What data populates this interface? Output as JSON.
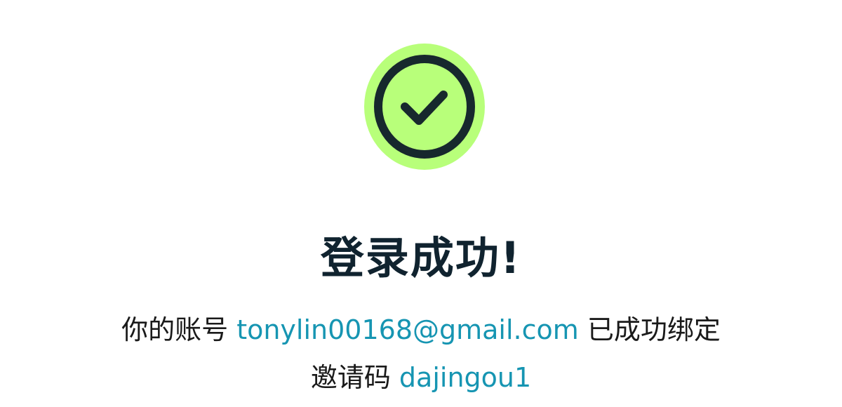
{
  "title": "登录成功!",
  "message": {
    "prefix": "你的账号",
    "email": "tonylin00168@gmail.com",
    "suffix": "已成功绑定"
  },
  "invite": {
    "label": "邀请码",
    "code": "dajingou1"
  },
  "colors": {
    "badge_fill": "#b8ff7a",
    "badge_ring": "#17282d",
    "title_text": "#10232f",
    "body_text": "#1a1a1a",
    "accent_text": "#1695b2",
    "background": "#ffffff"
  },
  "icons": {
    "status": "check-circle-icon"
  }
}
